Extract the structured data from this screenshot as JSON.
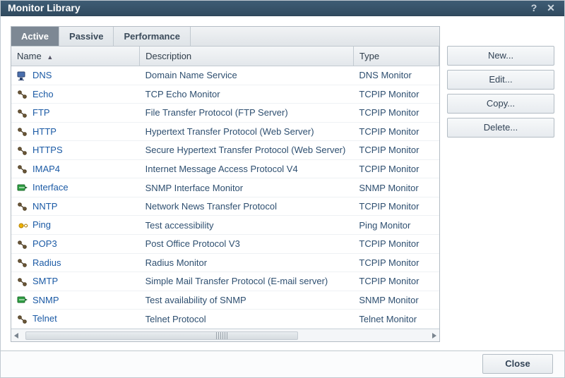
{
  "window": {
    "title": "Monitor Library"
  },
  "tabs": [
    {
      "label": "Active",
      "active": true
    },
    {
      "label": "Passive",
      "active": false
    },
    {
      "label": "Performance",
      "active": false
    }
  ],
  "columns": {
    "name": "Name",
    "description": "Description",
    "type": "Type",
    "sort": "asc",
    "sort_column": "Name"
  },
  "rows": [
    {
      "icon": "dns",
      "name": "DNS",
      "description": "Domain Name Service",
      "type": "DNS Monitor"
    },
    {
      "icon": "tcpip",
      "name": "Echo",
      "description": "TCP Echo Monitor",
      "type": "TCPIP Monitor"
    },
    {
      "icon": "tcpip",
      "name": "FTP",
      "description": "File Transfer Protocol (FTP Server)",
      "type": "TCPIP Monitor"
    },
    {
      "icon": "tcpip",
      "name": "HTTP",
      "description": "Hypertext Transfer Protocol (Web Server)",
      "type": "TCPIP Monitor"
    },
    {
      "icon": "tcpip",
      "name": "HTTPS",
      "description": "Secure Hypertext Transfer Protocol (Web Server)",
      "type": "TCPIP Monitor"
    },
    {
      "icon": "tcpip",
      "name": "IMAP4",
      "description": "Internet Message Access Protocol V4",
      "type": "TCPIP Monitor"
    },
    {
      "icon": "interface",
      "name": "Interface",
      "description": "SNMP Interface Monitor",
      "type": "SNMP Monitor"
    },
    {
      "icon": "tcpip",
      "name": "NNTP",
      "description": "Network News Transfer Protocol",
      "type": "TCPIP Monitor"
    },
    {
      "icon": "ping",
      "name": "Ping",
      "description": "Test accessibility",
      "type": "Ping Monitor"
    },
    {
      "icon": "tcpip",
      "name": "POP3",
      "description": "Post Office Protocol V3",
      "type": "TCPIP Monitor"
    },
    {
      "icon": "tcpip",
      "name": "Radius",
      "description": "Radius Monitor",
      "type": "TCPIP Monitor"
    },
    {
      "icon": "tcpip",
      "name": "SMTP",
      "description": "Simple Mail Transfer Protocol (E-mail server)",
      "type": "TCPIP Monitor"
    },
    {
      "icon": "interface",
      "name": "SNMP",
      "description": "Test availability of SNMP",
      "type": "SNMP Monitor"
    },
    {
      "icon": "tcpip",
      "name": "Telnet",
      "description": "Telnet Protocol",
      "type": "Telnet Monitor"
    }
  ],
  "actions": {
    "new": "New...",
    "edit": "Edit...",
    "copy": "Copy...",
    "delete": "Delete..."
  },
  "footer": {
    "close": "Close"
  },
  "icons": {
    "help": "?",
    "close": "✕"
  }
}
